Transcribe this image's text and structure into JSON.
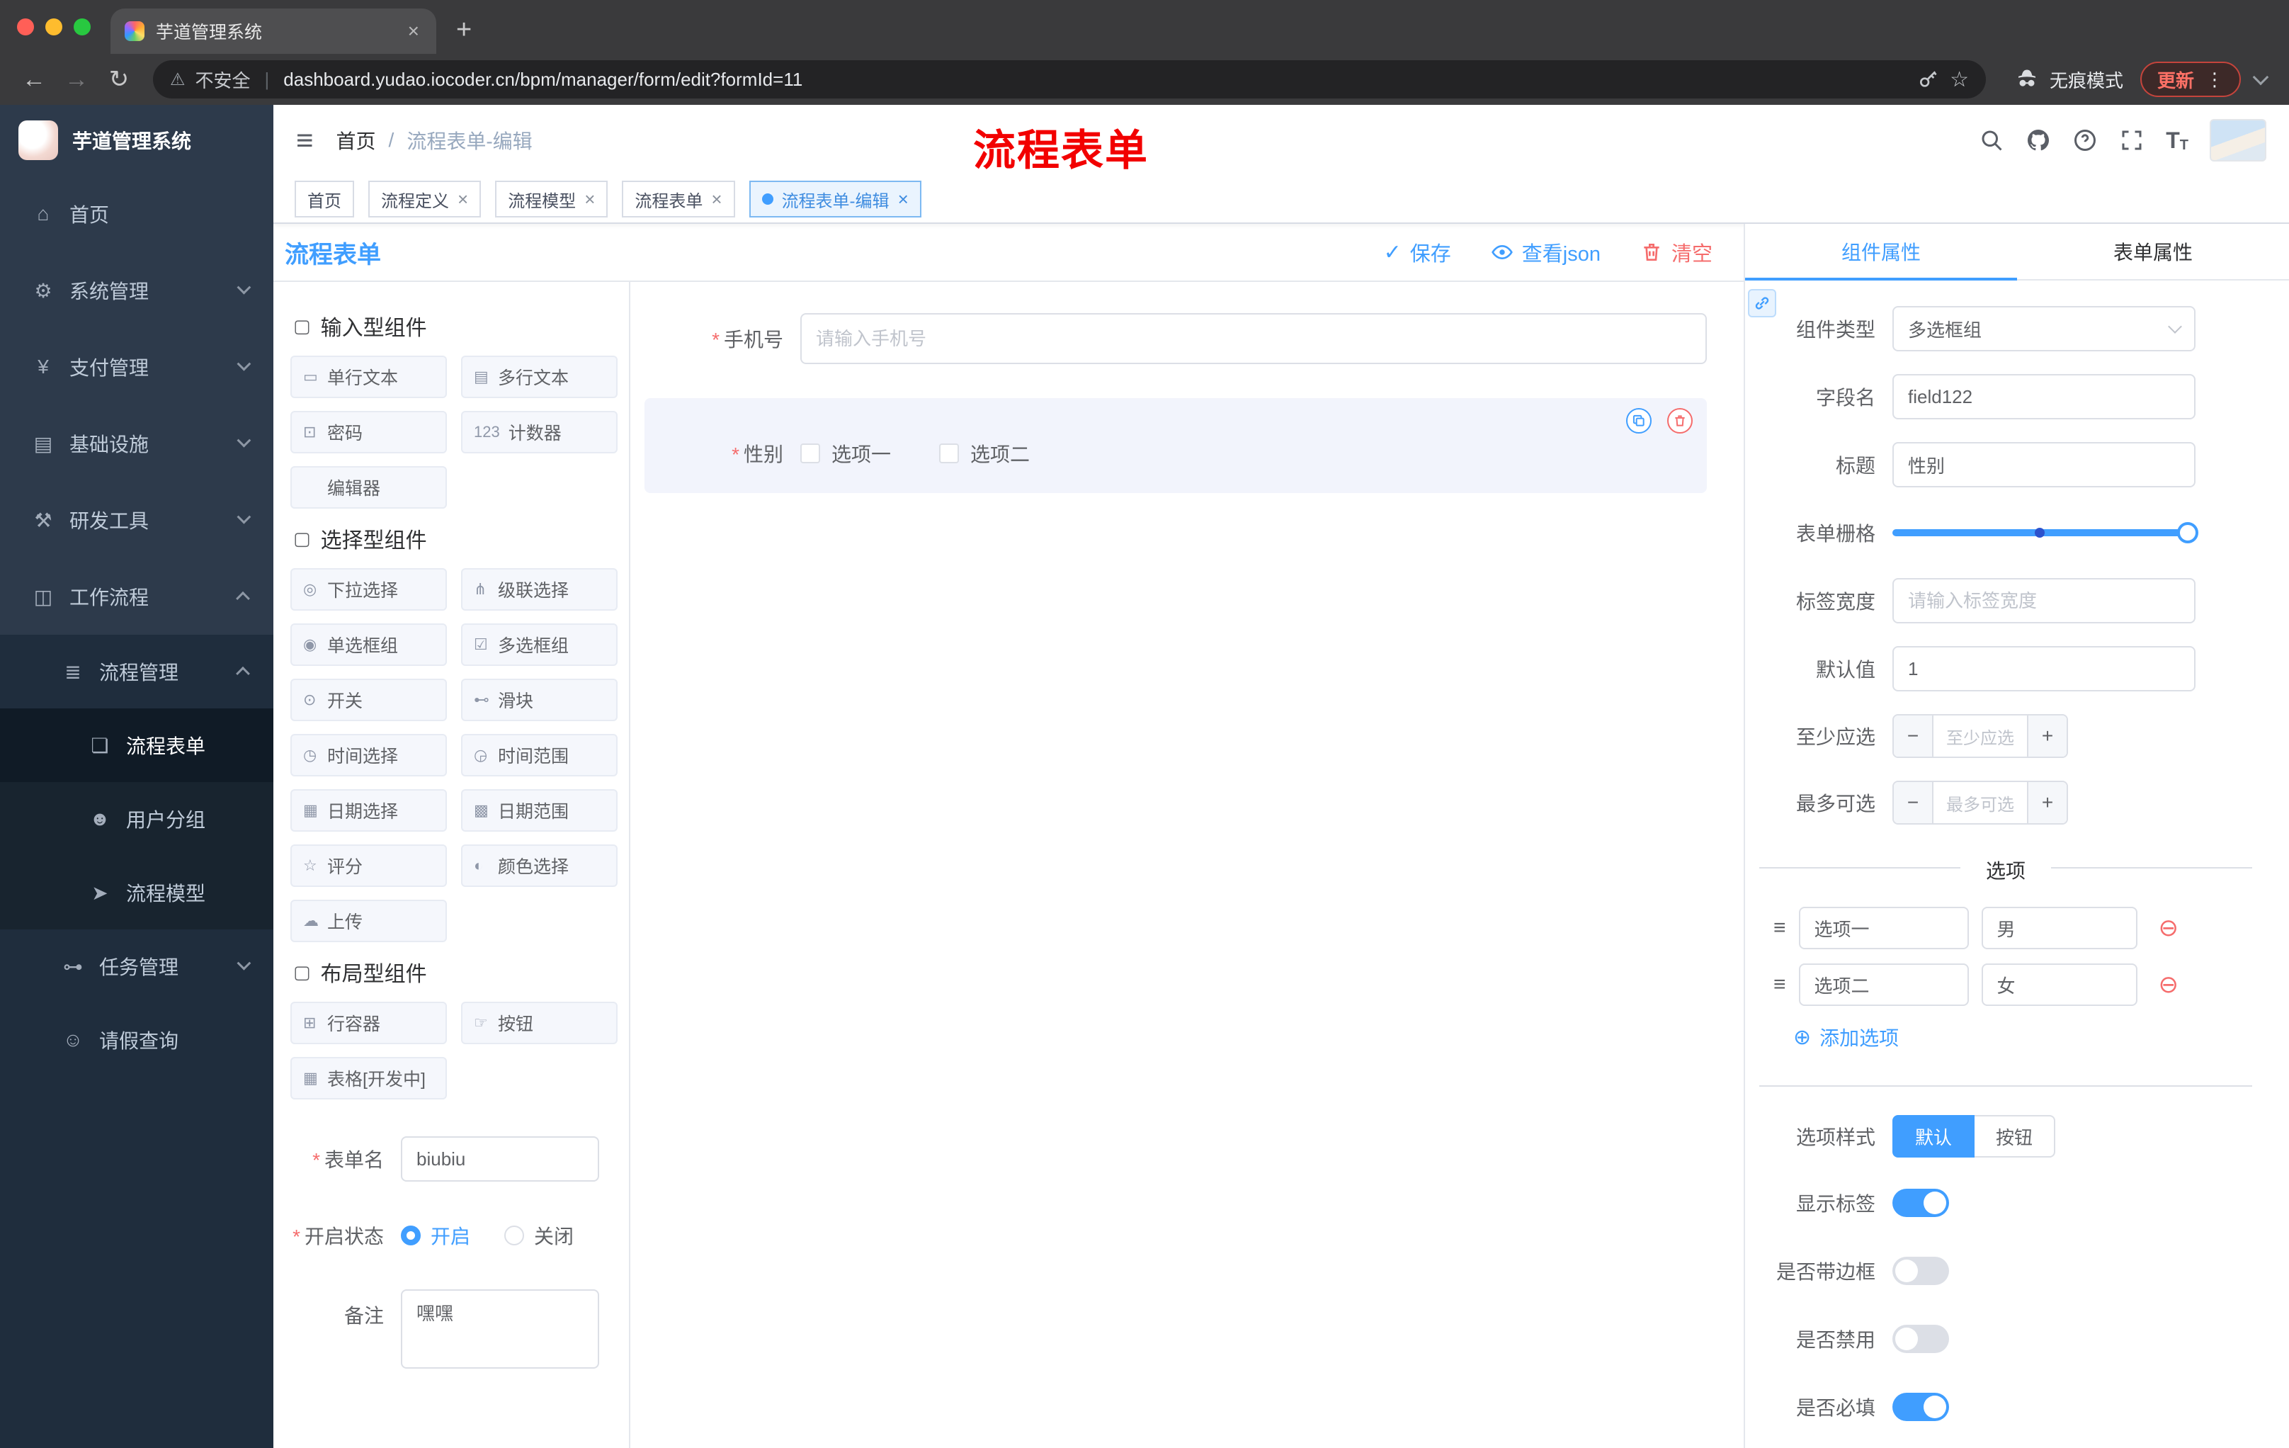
{
  "colors": {
    "accent": "#409eff",
    "danger": "#f56c6c",
    "sidebar_bg": "#2d3a4b",
    "sidebar_sub_bg": "#1f2d3d",
    "annotation_red": "#f20000"
  },
  "icons": {
    "close": "×",
    "new_tab": "+",
    "back": "←",
    "forward": "→",
    "reload": "↻",
    "warning": "⚠",
    "star": "☆",
    "kebab": "⋮",
    "hamburger": "≡",
    "required": "*",
    "check": "✓",
    "minus": "−",
    "plus": "+",
    "add_circle": "⊕",
    "remove_circle": "⊖",
    "drag": "≡",
    "divider_bar": "|",
    "font_size_big": "T",
    "font_size_small": "T"
  },
  "browser": {
    "tab_title": "芋道管理系统",
    "security_label": "不安全",
    "url": "dashboard.yudao.iocoder.cn/bpm/manager/form/edit?formId=11",
    "incognito_label": "无痕模式",
    "update_label": "更新"
  },
  "sidebar": {
    "logo_title": "芋道管理系统",
    "items": [
      {
        "icon": "⌂",
        "label": "首页"
      },
      {
        "icon": "⚙",
        "label": "系统管理"
      },
      {
        "icon": "¥",
        "label": "支付管理"
      },
      {
        "icon": "▤",
        "label": "基础设施"
      },
      {
        "icon": "⚒",
        "label": "研发工具"
      },
      {
        "icon": "◫",
        "label": "工作流程"
      }
    ],
    "submenu": {
      "icon": "≣",
      "label": "流程管理",
      "children": [
        {
          "icon": "❏",
          "label": "流程表单",
          "active": true
        },
        {
          "icon": "☻",
          "label": "用户分组",
          "active": false
        },
        {
          "icon": "➤",
          "label": "流程模型",
          "active": false
        }
      ]
    },
    "task_mgmt": {
      "icon": "⊶",
      "label": "任务管理"
    },
    "leave_query": {
      "icon": "☺",
      "label": "请假查询"
    }
  },
  "header": {
    "breadcrumb": [
      "首页",
      "流程表单-编辑"
    ],
    "breadcrumb_sep": "/",
    "annotation": "流程表单"
  },
  "tags": [
    {
      "label": "首页",
      "closable": false,
      "active": false
    },
    {
      "label": "流程定义",
      "closable": true,
      "active": false
    },
    {
      "label": "流程模型",
      "closable": true,
      "active": false
    },
    {
      "label": "流程表单",
      "closable": true,
      "active": false
    },
    {
      "label": "流程表单-编辑",
      "closable": true,
      "active": true
    }
  ],
  "designer": {
    "title": "流程表单",
    "actions": {
      "save": "保存",
      "view_json": "查看json",
      "clear": "清空"
    },
    "palette": {
      "groups": [
        {
          "icon": "▢",
          "title": "输入型组件",
          "items": [
            {
              "icon": "▭",
              "label": "单行文本"
            },
            {
              "icon": "▤",
              "label": "多行文本"
            },
            {
              "icon": "⊡",
              "label": "密码"
            },
            {
              "icon": "123",
              "label": "计数器"
            },
            {
              "icon": "",
              "label": "编辑器"
            }
          ]
        },
        {
          "icon": "▢",
          "title": "选择型组件",
          "items": [
            {
              "icon": "◎",
              "label": "下拉选择"
            },
            {
              "icon": "⋔",
              "label": "级联选择"
            },
            {
              "icon": "◉",
              "label": "单选框组"
            },
            {
              "icon": "☑",
              "label": "多选框组"
            },
            {
              "icon": "⊙",
              "label": "开关"
            },
            {
              "icon": "⊷",
              "label": "滑块"
            },
            {
              "icon": "◷",
              "label": "时间选择"
            },
            {
              "icon": "◶",
              "label": "时间范围"
            },
            {
              "icon": "▦",
              "label": "日期选择"
            },
            {
              "icon": "▩",
              "label": "日期范围"
            },
            {
              "icon": "☆",
              "label": "评分"
            },
            {
              "icon": "◐",
              "label": "颜色选择"
            },
            {
              "icon": "☁",
              "label": "上传"
            }
          ]
        },
        {
          "icon": "▢",
          "title": "布局型组件",
          "items": [
            {
              "icon": "⊞",
              "label": "行容器"
            },
            {
              "icon": "☞",
              "label": "按钮"
            },
            {
              "icon": "▦",
              "label": "表格[开发中]"
            }
          ]
        }
      ],
      "form": {
        "name_label": "表单名",
        "name_value": "biubiu",
        "status_label": "开启状态",
        "status_on": "开启",
        "status_off": "关闭",
        "remark_label": "备注",
        "remark_value": "嘿嘿"
      }
    },
    "canvas": {
      "phone": {
        "label": "手机号",
        "placeholder": "请输入手机号"
      },
      "gender": {
        "label": "性别",
        "options": [
          "选项一",
          "选项二"
        ]
      }
    },
    "props": {
      "tabs": [
        "组件属性",
        "表单属性"
      ],
      "rows": {
        "component_type": {
          "label": "组件类型",
          "value": "多选框组"
        },
        "field_name": {
          "label": "字段名",
          "value": "field122"
        },
        "title": {
          "label": "标题",
          "value": "性别"
        },
        "grid": {
          "label": "表单栅格"
        },
        "label_width": {
          "label": "标签宽度",
          "placeholder": "请输入标签宽度"
        },
        "default": {
          "label": "默认值",
          "value": "1"
        },
        "min": {
          "label": "至少应选",
          "placeholder": "至少应选"
        },
        "max": {
          "label": "最多可选",
          "placeholder": "最多可选"
        }
      },
      "options_divider": "选项",
      "options": [
        {
          "label": "选项一",
          "value": "男"
        },
        {
          "label": "选项二",
          "value": "女"
        }
      ],
      "add_option": "添加选项",
      "style": {
        "label": "选项样式",
        "default_btn": "默认",
        "button_btn": "按钮"
      },
      "switches": [
        {
          "label": "显示标签",
          "on": true
        },
        {
          "label": "是否带边框",
          "on": false
        },
        {
          "label": "是否禁用",
          "on": false
        },
        {
          "label": "是否必填",
          "on": true
        }
      ]
    }
  }
}
